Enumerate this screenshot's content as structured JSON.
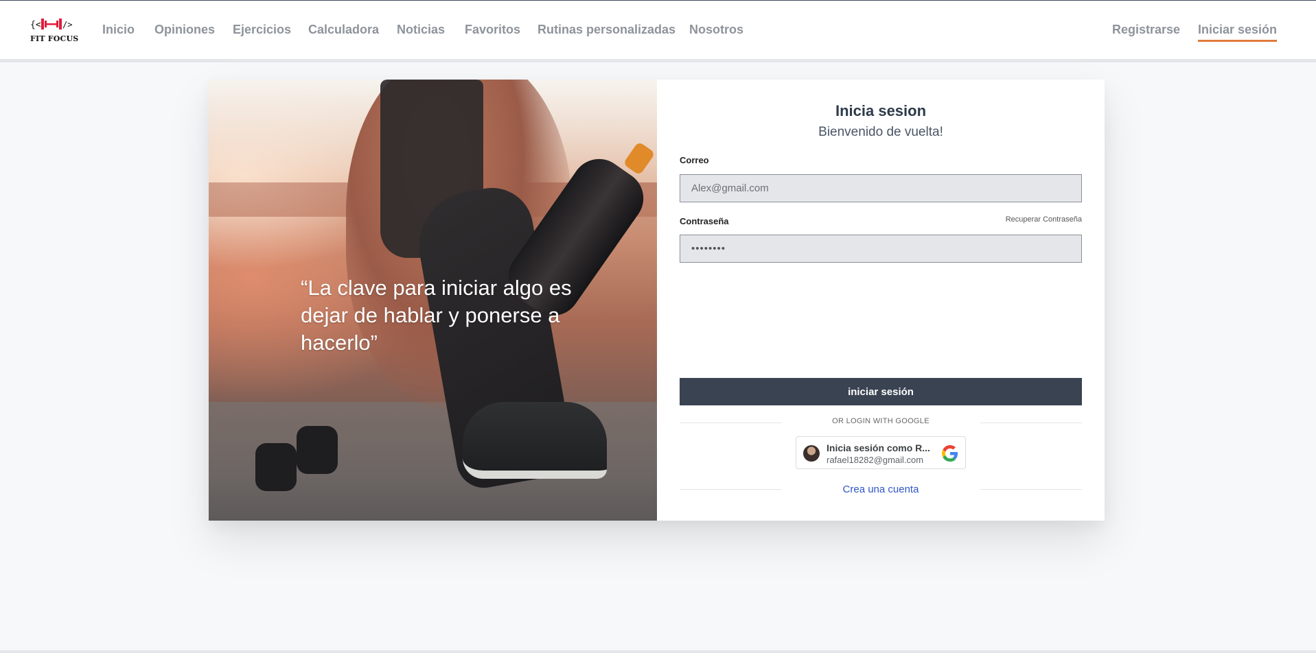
{
  "brand": {
    "name": "FIT FOCUS",
    "logo_icon": "dumbbell-code-icon",
    "accent": "#e31b3b"
  },
  "nav": {
    "links": [
      {
        "label": "Inicio"
      },
      {
        "label": "Opiniones"
      },
      {
        "label": "Ejercicios"
      },
      {
        "label": "Calculadora"
      },
      {
        "label": "Noticias"
      },
      {
        "label": "Favoritos"
      },
      {
        "label": "Rutinas personalizadas"
      },
      {
        "label": "Nosotros"
      }
    ],
    "register": "Registrarse",
    "login": "Iniciar sesión",
    "active_underline_color": "#e07a3a"
  },
  "hero": {
    "quote": "“La clave para iniciar algo es dejar de hablar y ponerse a hacerlo”"
  },
  "login_form": {
    "title": "Inicia sesion",
    "subtitle": "Bienvenido de vuelta!",
    "email_label": "Correo",
    "email_placeholder": "Alex@gmail.com",
    "password_label": "Contraseña",
    "password_value": "••••••••",
    "recover_link": "Recuperar Contraseña",
    "submit_label": "iniciar sesión",
    "submit_color": "#3a4352",
    "divider_text": "OR LOGIN WITH GOOGLE",
    "google_button": {
      "name_line": "Inicia sesión como R...",
      "email": "rafael18282@gmail.com",
      "icon": "google-g-icon"
    },
    "create_account": "Crea una cuenta",
    "link_color": "#2f55c7"
  }
}
